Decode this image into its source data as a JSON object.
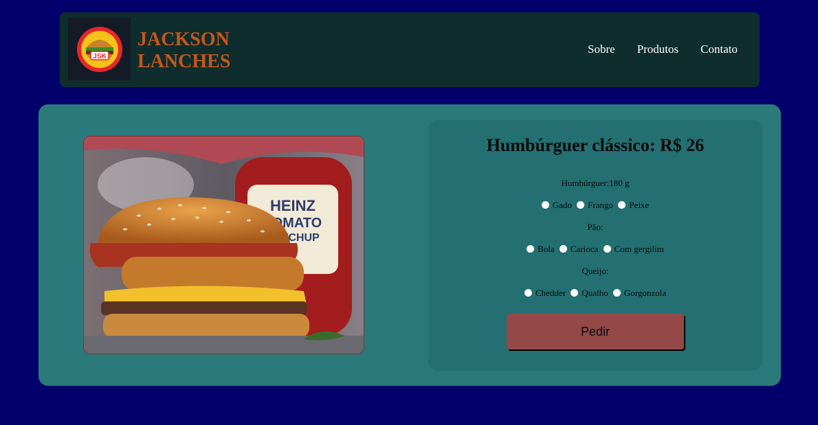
{
  "header": {
    "brand_line1": "JACKSON",
    "brand_line2": "LANCHES",
    "logo_text": "JSK",
    "nav": [
      "Sobre",
      "Produtos",
      "Contato"
    ]
  },
  "product": {
    "title": "Humbúrguer clássico: R$ 26",
    "image_label": "HEINZ TOMATO KETCHUP",
    "meat_label": "Humbúrguer:180 g",
    "meat_options": [
      "Gado",
      "Frango",
      "Peixe"
    ],
    "bread_label": "Pão:",
    "bread_options": [
      "Bola",
      "Carioca",
      "Com gergilim"
    ],
    "cheese_label": "Queijo:",
    "cheese_options": [
      "Chedder",
      "Qualho",
      "Gorgonzola"
    ],
    "order_button": "Pedir"
  },
  "colors": {
    "page_bg": "#02006b",
    "header_bg": "#0f2d2d",
    "brand": "#c8561b",
    "panel_bg": "#2b7a7b",
    "card_bg": "#236f72",
    "button_bg": "#944848"
  }
}
